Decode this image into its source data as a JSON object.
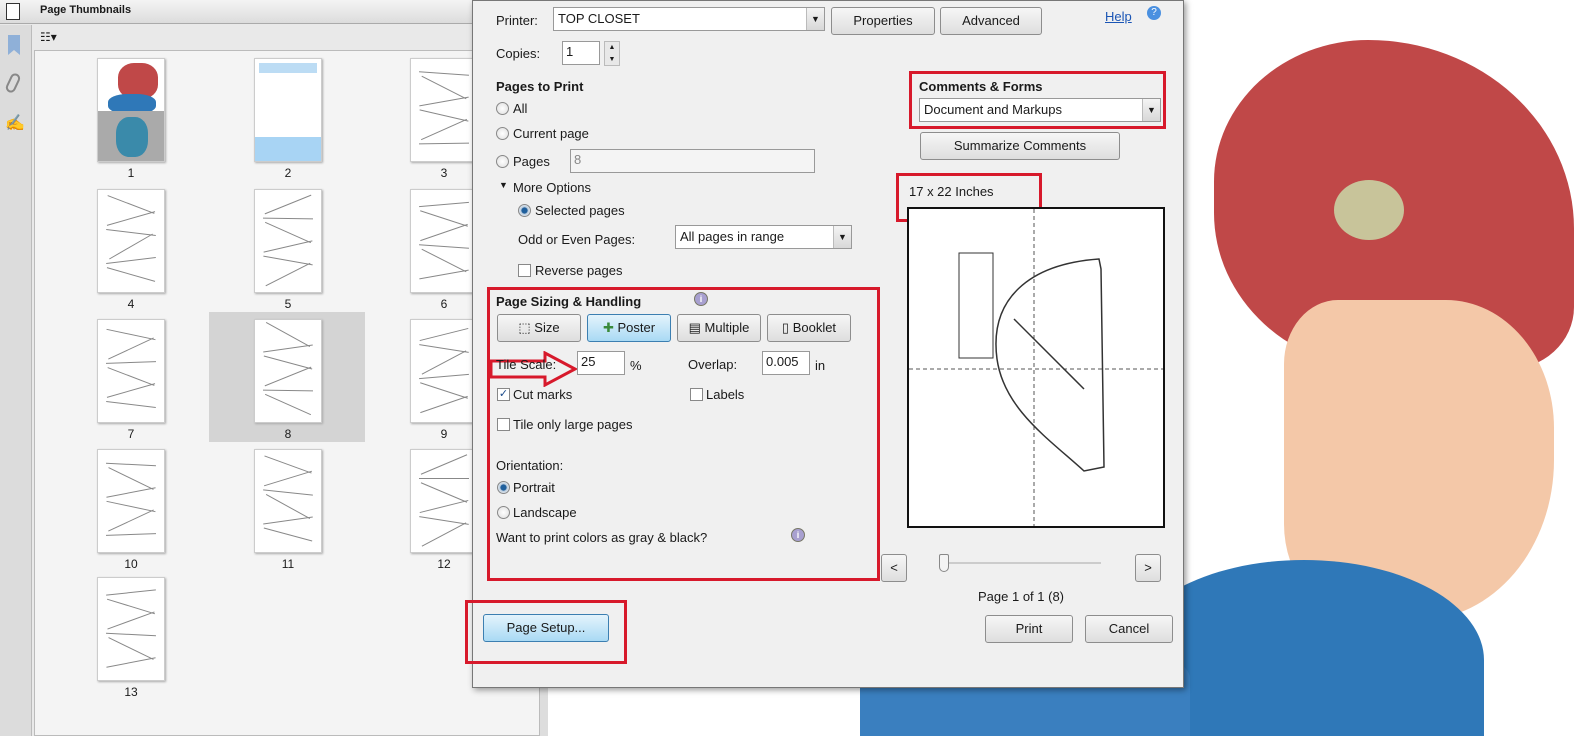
{
  "left_panel": {
    "title": "Page Thumbnails",
    "rail_icons": [
      "bookmark-icon",
      "paperclip-icon",
      "signature-icon"
    ],
    "options_icon": "thumbnail-options-icon",
    "thumbnails": [
      {
        "label": "1"
      },
      {
        "label": "2"
      },
      {
        "label": "3"
      },
      {
        "label": "4"
      },
      {
        "label": "5"
      },
      {
        "label": "6"
      },
      {
        "label": "7"
      },
      {
        "label": "8",
        "selected": true
      },
      {
        "label": "9"
      },
      {
        "label": "10"
      },
      {
        "label": "11"
      },
      {
        "label": "12"
      },
      {
        "label": "13"
      }
    ]
  },
  "dialog": {
    "printer_label": "Printer:",
    "printer_value": "TOP CLOSET",
    "properties": "Properties",
    "advanced": "Advanced",
    "help": "Help",
    "copies_label": "Copies:",
    "copies_value": "1",
    "pages_to_print": "Pages to Print",
    "all": "All",
    "current_page": "Current page",
    "pages": "Pages",
    "pages_value": "8",
    "more_options": "More Options",
    "selected_pages": "Selected pages",
    "odd_even_label": "Odd or Even Pages:",
    "odd_even_value": "All pages in range",
    "reverse_pages": "Reverse pages",
    "sizing_title": "Page Sizing & Handling",
    "size": "Size",
    "poster": "Poster",
    "multiple": "Multiple",
    "booklet": "Booklet",
    "tile_scale_label": "Tile Scale:",
    "tile_scale_value": "25",
    "percent": "%",
    "overlap_label": "Overlap:",
    "overlap_value": "0.005",
    "overlap_unit": "in",
    "cut_marks": "Cut marks",
    "cut_marks_checked": true,
    "labels": "Labels",
    "labels_checked": false,
    "tile_large": "Tile only large pages",
    "tile_large_checked": false,
    "orientation_label": "Orientation:",
    "portrait": "Portrait",
    "landscape": "Landscape",
    "orientation_selected": "Portrait",
    "gray_question": "Want to print colors as gray & black?",
    "comments_forms": "Comments & Forms",
    "comments_value": "Document and Markups",
    "summarize": "Summarize Comments",
    "paper_size": "17 x 22 Inches",
    "prev": "<",
    "next": ">",
    "page_status": "Page 1 of 1 (8)",
    "page_setup": "Page Setup...",
    "print": "Print",
    "cancel": "Cancel"
  },
  "colors": {
    "highlight": "#d7192b",
    "poster_active": "#a9daf4",
    "hat": "#c84a4a",
    "scarf": "#2f78b8"
  }
}
